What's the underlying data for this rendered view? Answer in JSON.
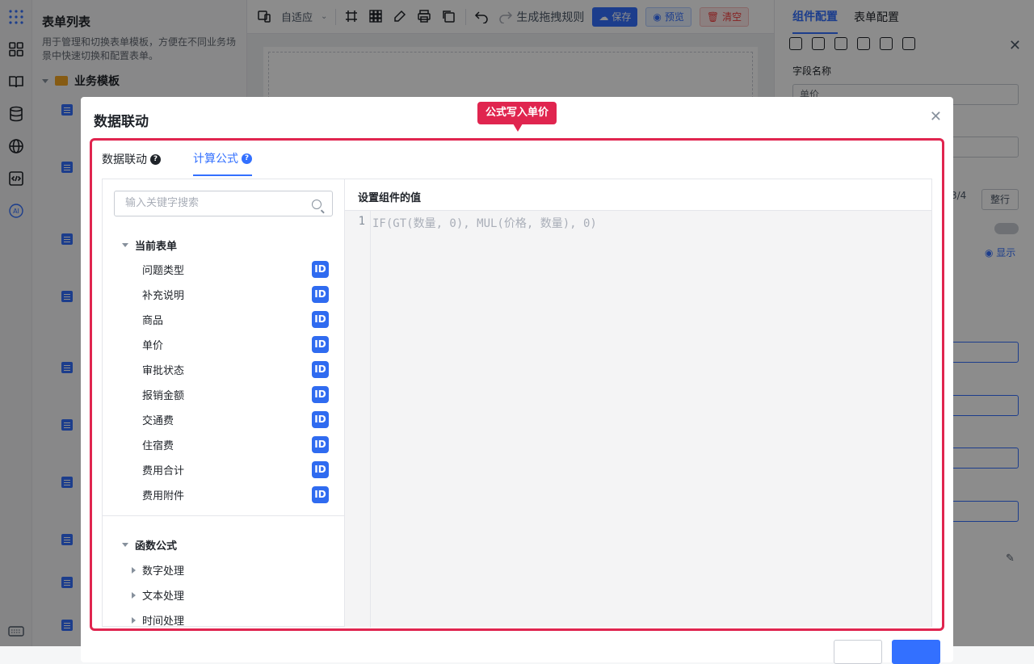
{
  "sidebar_rail": {
    "icons": [
      "grid-dots-icon",
      "apps-icon",
      "book-icon",
      "database-icon",
      "globe-icon",
      "code-icon",
      "ai-icon",
      "keyboard-icon"
    ]
  },
  "form_list": {
    "title": "表单列表",
    "description": "用于管理和切换表单模板，方便在不同业务场景中快速切换和配置表单。",
    "folder": "业务模板"
  },
  "toolbar": {
    "adapt_label": "自适应",
    "rule_label": "生成拖拽规则",
    "save_label": "保存",
    "preview_label": "预览",
    "clear_label": "清空"
  },
  "config_panel": {
    "tab_component": "组件配置",
    "tab_form": "表单配置",
    "field_name_label": "字段名称",
    "field_name_value": "单价",
    "width_value": "3/4",
    "width_full": "整行",
    "show_label": "显示"
  },
  "modal": {
    "title": "数据联动",
    "callout": "公式写入单价",
    "tabs": [
      {
        "label": "数据联动",
        "active": false
      },
      {
        "label": "计算公式",
        "active": true
      }
    ],
    "search_placeholder": "输入关键字搜索",
    "current_form_label": "当前表单",
    "fields": [
      "问题类型",
      "补充说明",
      "商品",
      "单价",
      "审批状态",
      "报销金额",
      "交通费",
      "住宿费",
      "费用合计",
      "费用附件"
    ],
    "id_badge": "ID",
    "functions_label": "函数公式",
    "function_groups": [
      "数字处理",
      "文本处理",
      "时间处理"
    ],
    "editor_title": "设置组件的值",
    "line_number": "1",
    "formula": "IF(GT(数量, 0), MUL(价格, 数量), 0)"
  },
  "colors": {
    "accent": "#3370ff",
    "highlight": "#e0254f"
  }
}
